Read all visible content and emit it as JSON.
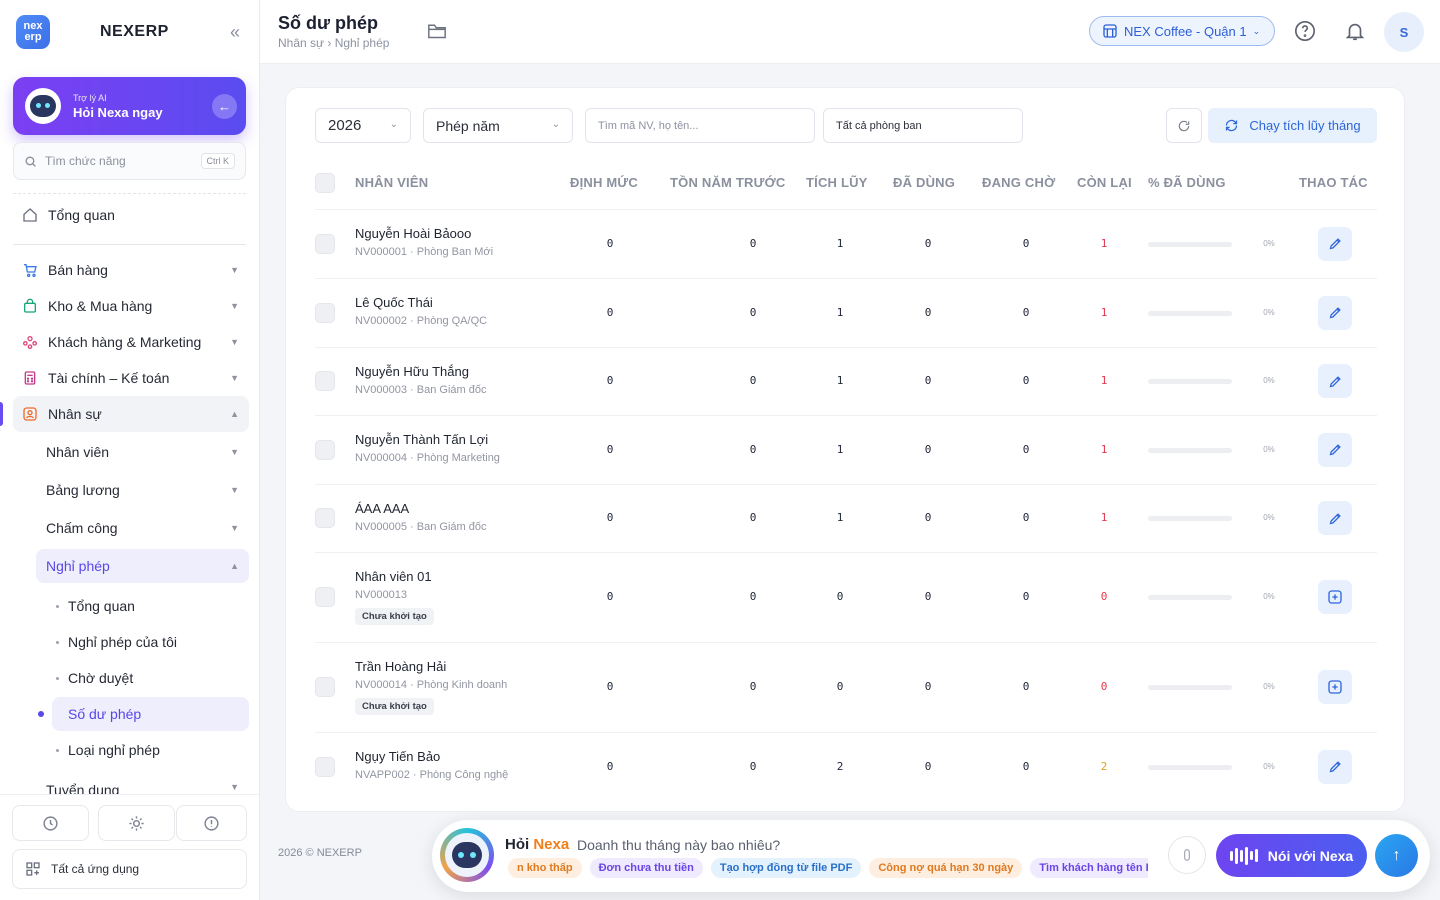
{
  "brand": {
    "name": "NEXERP",
    "logo_top": "nex",
    "logo_bottom": "erp"
  },
  "ai": {
    "small": "Trợ lý AI",
    "big": "Hỏi Nexa ngay"
  },
  "search_fn": {
    "placeholder": "Tìm chức năng",
    "shortcut": "Ctrl K"
  },
  "nav": {
    "overview": "Tổng quan",
    "sales": "Bán hàng",
    "inventory": "Kho & Mua hàng",
    "crm": "Khách hàng & Marketing",
    "finance": "Tài chính – Kế toán",
    "hr": "Nhân sự",
    "hr_sub": {
      "employees": "Nhân viên",
      "payroll": "Bảng lương",
      "attendance": "Chấm công",
      "leave": "Nghỉ phép",
      "recruit": "Tuyển dụng"
    },
    "leave_sub": [
      "Tổng quan",
      "Nghỉ phép của tôi",
      "Chờ duyệt",
      "Số dư phép",
      "Loại nghỉ phép"
    ]
  },
  "sidebar_bottom": {
    "all_apps": "Tất cả ứng dụng"
  },
  "header": {
    "title": "Số dư phép",
    "breadcrumb": "Nhân sự › Nghỉ phép",
    "branch": "NEX Coffee - Quận 1",
    "user_initial": "S"
  },
  "filters": {
    "year": "2026",
    "leave_type": "Phép năm",
    "search_placeholder": "Tìm mã NV, họ tên...",
    "department": "Tất cả phòng ban",
    "run_button": "Chạy tích lũy tháng"
  },
  "columns": {
    "employee": "NHÂN VIÊN",
    "quota": "ĐỊNH MỨC",
    "carry": "TỒN NĂM TRƯỚC",
    "accrued": "TÍCH LŨY",
    "used": "ĐÃ DÙNG",
    "pending": "ĐANG CHỜ",
    "remaining": "CÒN LẠI",
    "pct_used": "% ĐÃ DÙNG",
    "actions": "THAO TÁC"
  },
  "rows": [
    {
      "name": "Nguyễn Hoài Bảooo",
      "sub": "NV000001 · Phòng Ban Mới",
      "badge": "",
      "quota": "0",
      "carry": "0",
      "accrued": "1",
      "used": "0",
      "pending": "0",
      "remaining": "1",
      "pct": "0%",
      "pct_value": 0,
      "action": "edit"
    },
    {
      "name": "Lê Quốc Thái",
      "sub": "NV000002 · Phòng QA/QC",
      "badge": "",
      "quota": "0",
      "carry": "0",
      "accrued": "1",
      "used": "0",
      "pending": "0",
      "remaining": "1",
      "pct": "0%",
      "pct_value": 0,
      "action": "edit"
    },
    {
      "name": "Nguyễn Hữu Thắng",
      "sub": "NV000003 · Ban Giám đốc",
      "badge": "",
      "quota": "0",
      "carry": "0",
      "accrued": "1",
      "used": "0",
      "pending": "0",
      "remaining": "1",
      "pct": "0%",
      "pct_value": 0,
      "action": "edit"
    },
    {
      "name": "Nguyễn Thành Tấn Lợi",
      "sub": "NV000004 · Phòng Marketing",
      "badge": "",
      "quota": "0",
      "carry": "0",
      "accrued": "1",
      "used": "0",
      "pending": "0",
      "remaining": "1",
      "pct": "0%",
      "pct_value": 0,
      "action": "edit"
    },
    {
      "name": "ÁAA AAA",
      "sub": "NV000005 · Ban Giám đốc",
      "badge": "",
      "quota": "0",
      "carry": "0",
      "accrued": "1",
      "used": "0",
      "pending": "0",
      "remaining": "1",
      "pct": "0%",
      "pct_value": 0,
      "action": "edit"
    },
    {
      "name": "Nhân viên 01",
      "sub": "NV000013",
      "badge": "Chưa khởi tạo",
      "quota": "0",
      "carry": "0",
      "accrued": "0",
      "used": "0",
      "pending": "0",
      "remaining": "0",
      "pct": "0%",
      "pct_value": 0,
      "action": "add"
    },
    {
      "name": "Trần Hoàng Hải",
      "sub": "NV000014 · Phòng Kinh doanh",
      "badge": "Chưa khởi tạo",
      "quota": "0",
      "carry": "0",
      "accrued": "0",
      "used": "0",
      "pending": "0",
      "remaining": "0",
      "pct": "0%",
      "pct_value": 0,
      "action": "add"
    },
    {
      "name": "Ngụy Tiến Bảo",
      "sub": "NVAPP002 · Phòng Công nghệ",
      "badge": "",
      "quota": "0",
      "carry": "0",
      "accrued": "2",
      "used": "0",
      "pending": "0",
      "remaining": "2",
      "pct": "0%",
      "pct_value": 0,
      "action": "edit"
    }
  ],
  "footer": {
    "copyright": "2026 © NEXERP"
  },
  "nexa": {
    "hoi": "Hỏi",
    "nexa": "Nexa",
    "question": "Doanh thu tháng này bao nhiêu?",
    "talk": "Nói với Nexa",
    "chips": [
      {
        "text": "n kho thấp",
        "bg": "#fdeee0",
        "fg": "#e07a1d"
      },
      {
        "text": "Đơn chưa thu tiền",
        "bg": "#efeafe",
        "fg": "#6a45e6"
      },
      {
        "text": "Tạo hợp đồng từ file PDF",
        "bg": "#e4f2fd",
        "fg": "#2a6fc8"
      },
      {
        "text": "Công nợ quá hạn 30 ngày",
        "bg": "#fdeee0",
        "fg": "#e07a1d"
      },
      {
        "text": "Tìm khách hàng tên Hậu",
        "bg": "#efeafe",
        "fg": "#6a45e6"
      }
    ]
  },
  "colors": {
    "accent": "#6a4cf2",
    "blue": "#2c66d8",
    "danger": "#e5384d",
    "warning": "#e0a21b"
  }
}
